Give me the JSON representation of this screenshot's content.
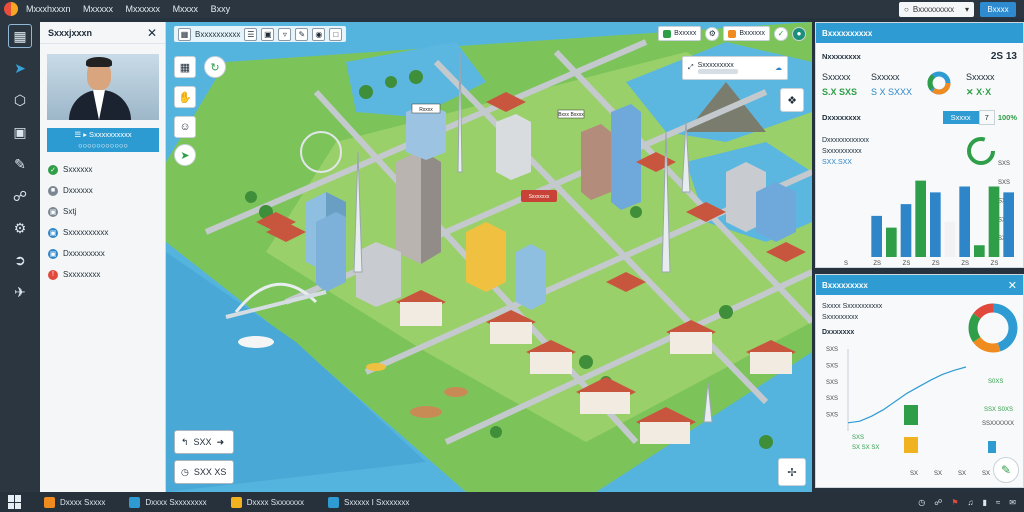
{
  "topbar": {
    "menu": [
      "Mxxxhxxxn",
      "Mxxxxx",
      "Mxxxxxx",
      "Mxxxx",
      "Bxxy"
    ],
    "account_label": "Bxxxxxxxxx",
    "button_label": "Bxxxx"
  },
  "selection": {
    "title": "Sxxxjxxxn",
    "name_line1": "☰ ▸ Sxxxxxxxxxx",
    "name_line2": "○○○○○○○○○○○",
    "items": [
      {
        "label": "Sxxxxxx",
        "color": "#2f9e48"
      },
      {
        "label": "Dxxxxxx",
        "color": "#7a8793"
      },
      {
        "label": "Sxtj",
        "color": "#7a8793"
      },
      {
        "label": "Sxxxxxxxxxx",
        "color": "#2e86c9"
      },
      {
        "label": "Dxxxxxxxxx",
        "color": "#2e86c9"
      },
      {
        "label": "Sxxxxxxxx",
        "color": "#e0493c"
      }
    ]
  },
  "map": {
    "toolbar_label": "Bxxxxxxxxxx",
    "top_chips": [
      {
        "label": "Bxxxxx",
        "color": "#2f9e48"
      },
      {
        "label": "Bxxxxxx",
        "color": "#f08b1f"
      }
    ],
    "info_label": "Sxxxxxxxxx",
    "route_top_label": "SXX",
    "route_bottom_label": "SXX XS",
    "labels": [
      "Rxxxx",
      "Sxxxxxxx",
      "Bxxx Bxxxx"
    ]
  },
  "overview": {
    "title": "Bxxxxxxxxxx",
    "subtitle": "Nxxxxxxxx",
    "top_values": [
      "2S 13"
    ],
    "stats": [
      {
        "label": "Sxxxxx",
        "value": "S.X SXS"
      },
      {
        "label": "Sxxxxx",
        "value": "S X SXXX"
      },
      {
        "label": "Sxxxxx",
        "value": "✕ X·X"
      }
    ],
    "section2": "Dxxxxxxxx",
    "tab_label": "Sxxxx",
    "tab_value": "7",
    "pct_value": "100%",
    "desc_line1": "Dxxxxxxxxxxxx",
    "desc_line2": "Sxxxxxxxxxx",
    "desc_line3": "SXX.SXX",
    "axis": [
      "SXS",
      "SXS",
      "SXS",
      "SXS",
      "SXS"
    ],
    "xticks": [
      "S",
      "ZS",
      "ZS",
      "ZS",
      "ZS",
      "ZS"
    ]
  },
  "chart_data": [
    {
      "type": "bar",
      "categories": [
        "1",
        "2",
        "3",
        "4",
        "5",
        "6",
        "7",
        "8",
        "9",
        "10",
        "11",
        "12"
      ],
      "series": [
        {
          "values": [
            0,
            0,
            3.5,
            2.5,
            4.5,
            6.5,
            5.5,
            3.0,
            6.0,
            1.0,
            6.0,
            5.5
          ]
        }
      ],
      "colors": [
        "#2f9e48",
        "#2e86c9",
        "#2e86c9",
        "#2f9e48",
        "#2e86c9",
        "#2f9e48",
        "#2e86c9",
        "#f2f2f2",
        "#2e86c9",
        "#2f9e48",
        "#2f9e48",
        "#2e86c9"
      ],
      "ylim": [
        0,
        8
      ]
    },
    {
      "type": "line",
      "x": [
        0,
        1,
        2,
        3,
        4,
        5,
        6,
        7,
        8,
        9,
        10
      ],
      "values": [
        1.0,
        1.2,
        1.8,
        2.6,
        3.6,
        4.6,
        5.4,
        6.2,
        6.9,
        7.4,
        7.8
      ],
      "ylim": [
        0,
        10
      ]
    },
    {
      "type": "pie",
      "values": [
        45,
        20,
        20,
        15
      ],
      "colors": [
        "#2e9bd2",
        "#f08b1f",
        "#2f9e48",
        "#e0493c"
      ]
    }
  ],
  "trend": {
    "title": "Bxxxxxxxxx",
    "sub1": "Sxxxx Sxxxxxxxxxx",
    "sub2": "Sxxxxxxxxx",
    "sub3": "Dxxxxxxx",
    "right_values": [
      "S0XS",
      "SSX S0XS",
      "SSXXXXXX"
    ],
    "bottom_row": [
      "SXS",
      "SX SX SX",
      "SX",
      "SX",
      "SX",
      "SX"
    ]
  },
  "taskbar": {
    "tasks": [
      {
        "label": "Dxxxx Sxxxx",
        "color": "#f08b1f"
      },
      {
        "label": "Dxxxx Sxxxxxxxx",
        "color": "#2e9bd2"
      },
      {
        "label": "Dxxxx Sxxxxxxx",
        "color": "#f0b21f"
      },
      {
        "label": "Sxxxxx I Sxxxxxxx",
        "color": "#2e9bd2"
      }
    ]
  }
}
